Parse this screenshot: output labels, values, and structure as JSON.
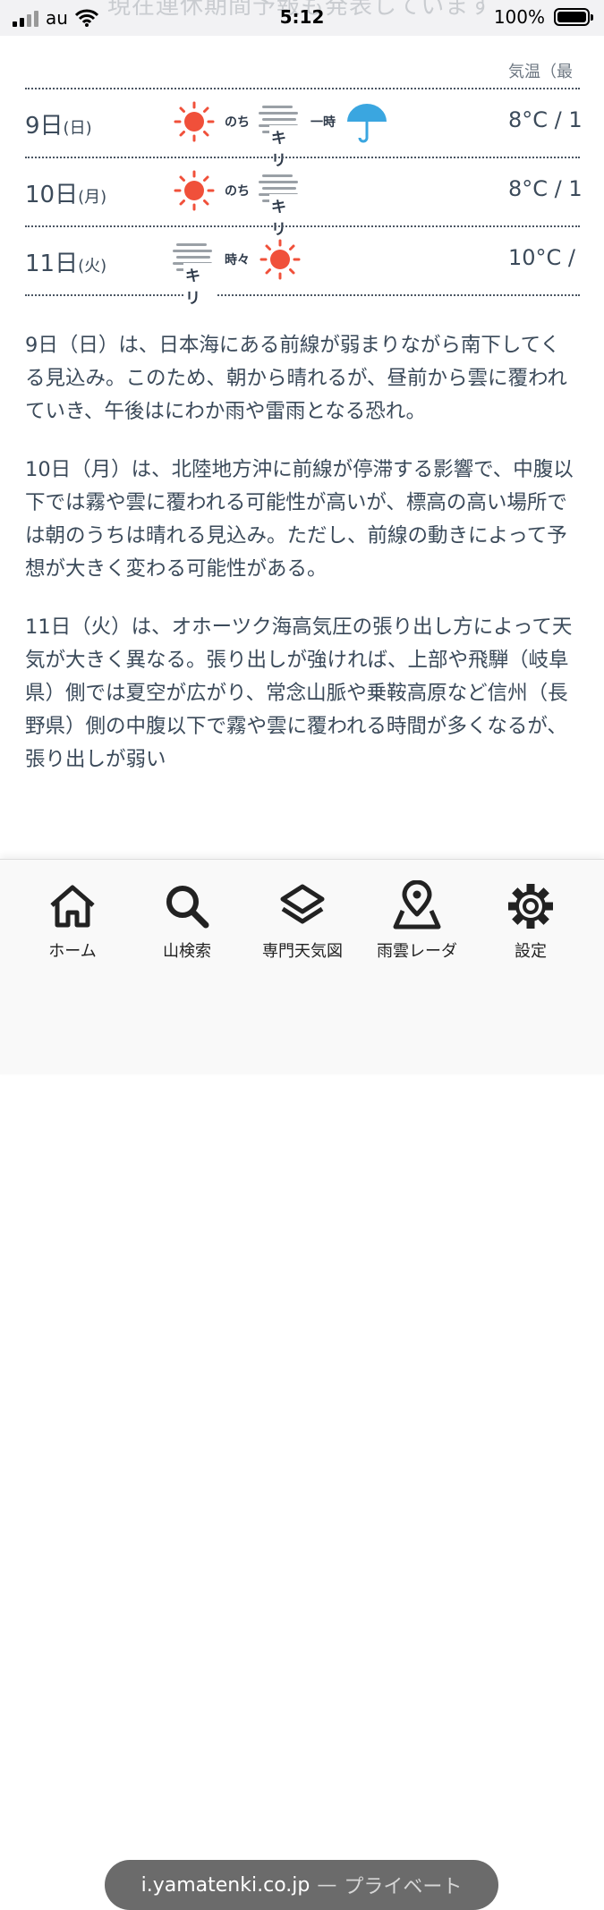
{
  "status_bar": {
    "carrier": "au",
    "time": "5:12",
    "battery": "100%",
    "ghost_text": "現在連休期間予報も発表しています"
  },
  "forecast": {
    "temp_header": "気温（最",
    "rows": [
      {
        "day": "9日",
        "weekday": "(日)",
        "word1": "のち",
        "fog_label": "キリ",
        "word2": "一時",
        "temp": "8°C / 1"
      },
      {
        "day": "10日",
        "weekday": "(月)",
        "word1": "のち",
        "fog_label": "キリ",
        "temp": "8°C / 1"
      },
      {
        "day": "11日",
        "weekday": "(火)",
        "fog_label": "キリ",
        "word1": "時々",
        "temp": "10°C /"
      }
    ]
  },
  "article": {
    "paragraphs": [
      "9日（日）は、日本海にある前線が弱まりながら南下してくる見込み。このため、朝から晴れるが、昼前から雲に覆われていき、午後はにわか雨や雷雨となる恐れ。",
      "10日（月）は、北陸地方沖に前線が停滞する影響で、中腹以下では霧や雲に覆われる可能性が高いが、標高の高い場所では朝のうちは晴れる見込み。ただし、前線の動きによって予想が大きく変わる可能性がある。",
      "11日（火）は、オホーツク海高気圧の張り出し方によって天気が大きく異なる。張り出しが強ければ、上部や飛騨（岐阜県）側では夏空が広がり、常念山脈や乗鞍高原など信州（長野県）側の中腹以下で霧や雲に覆われる時間が多くなるが、張り出しが弱い"
    ]
  },
  "tabs": [
    {
      "label": "ホーム",
      "icon": "home-icon"
    },
    {
      "label": "山検索",
      "icon": "search-icon"
    },
    {
      "label": "専門天気図",
      "icon": "layers-icon"
    },
    {
      "label": "雨雲レーダ",
      "icon": "map-pin-icon"
    },
    {
      "label": "設定",
      "icon": "gear-icon"
    }
  ],
  "url_bar": {
    "domain": "i.yamatenki.co.jp",
    "separator": "—",
    "mode": "プライベート"
  },
  "colors": {
    "sun": "#f0503a",
    "umbrella": "#3aa6e0",
    "text": "#3b4a5a"
  }
}
